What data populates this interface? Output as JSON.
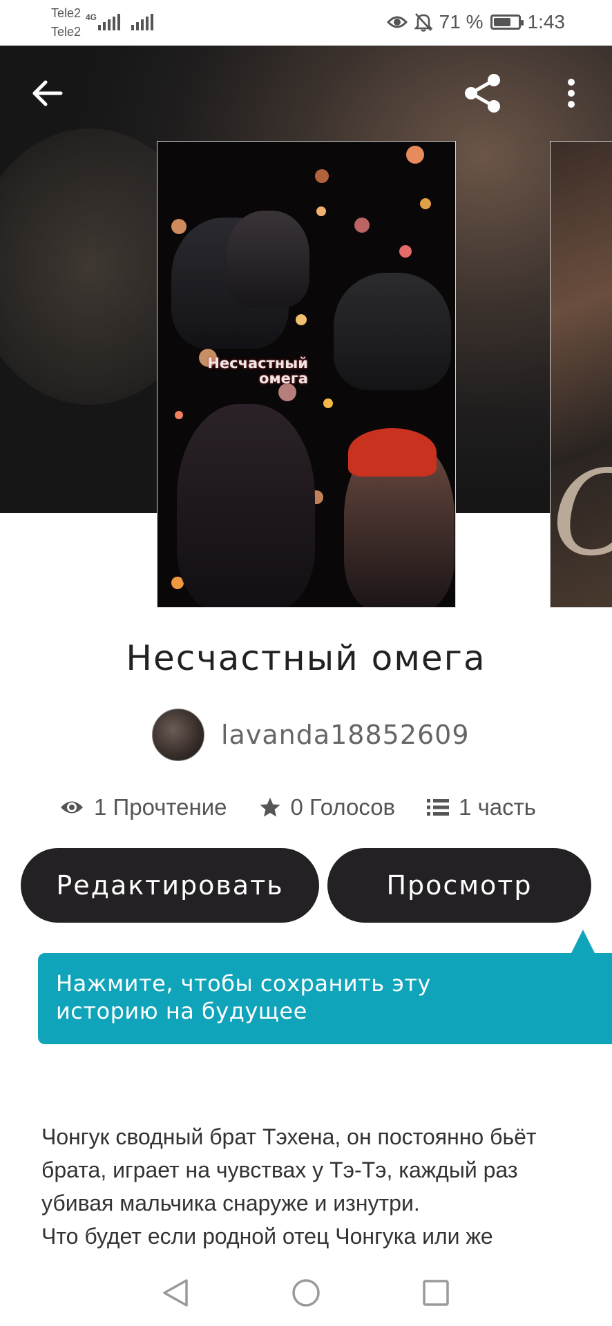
{
  "status_bar": {
    "carrier1": "Tele2",
    "carrier2": "Tele2",
    "network_type": "4G",
    "battery_percent": "71 %",
    "battery_level": 0.71,
    "time": "1:43",
    "icons": [
      "eye-comfort-icon",
      "bell-off-icon",
      "battery-icon"
    ]
  },
  "header": {
    "back_icon": "arrow-left-icon",
    "share_icon": "share-icon",
    "menu_icon": "more-vertical-icon"
  },
  "cover": {
    "title_line1": "Несчастный",
    "title_line2": "омега"
  },
  "story": {
    "title": "Несчастный омега",
    "author": "lavanda18852609",
    "stats": {
      "reads": "1 Прочтение",
      "votes": "0 Голосов",
      "parts": "1 часть"
    }
  },
  "actions": {
    "edit_label": "Редактировать",
    "view_label": "Просмотр"
  },
  "tooltip": {
    "line1": "Нажмите, чтобы сохранить эту",
    "line2": "историю на будущее"
  },
  "description": {
    "line1": "Чонгук сводный брат Тэхена, он постоянно бьёт",
    "line2": "брата, играет на чувствах у Тэ-Тэ, каждый раз",
    "line3": "убивая мальчика снаруже и изнутри.",
    "line4": "Что будет если родной отец Чонгука или же"
  },
  "colors": {
    "button_bg": "#232123",
    "tooltip_bg": "#0fa4ba",
    "text_primary": "#222222",
    "text_secondary": "#555555"
  }
}
